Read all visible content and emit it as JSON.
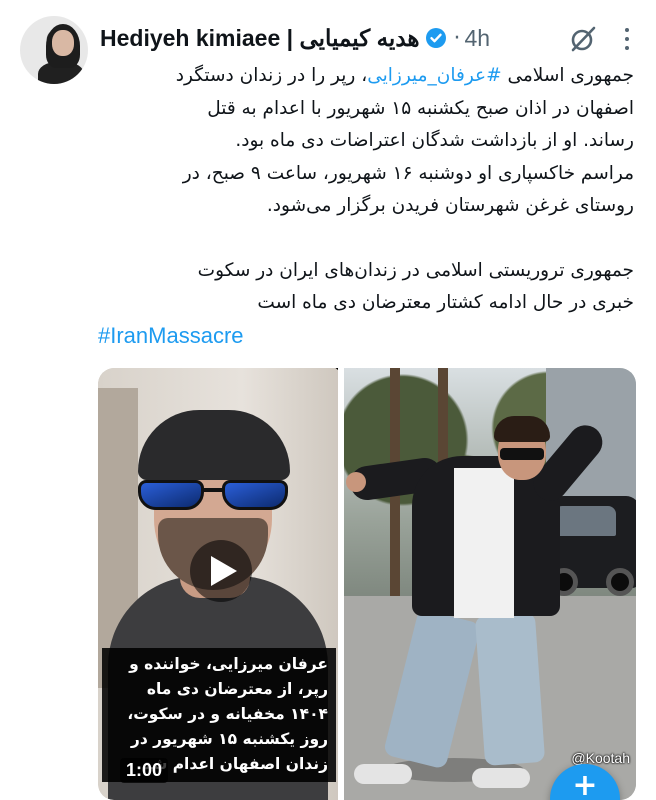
{
  "author": {
    "display_name": "Hediyeh kimiaee | هدیه کیمیایی",
    "separator": "·",
    "time": "4h"
  },
  "post": {
    "lines": [
      {
        "prefix": "جمهوری اسلامی ",
        "hashtag": "#عرفان_میرزایی",
        "suffix": "، رپر را در زندان دستگرد"
      },
      {
        "text": "اصفهان در اذان صبح یکشنبه ۱۵ شهریور با اعدام به قتل"
      },
      {
        "text": "رساند. او از بازداشت شدگان اعتراضات دی ماه بود."
      },
      {
        "text": "مراسم خاکسپاری او دوشنبه ۱۶ شهریور، ساعت ۹ صبح، در"
      },
      {
        "text": "روستای غرغن شهرستان فریدن برگزار می‌شود."
      },
      {
        "text": "جمهوری تروریستی اسلامی در زندان‌های ایران در سکوت"
      },
      {
        "text": "خبری در حال ادامه کشتار معترضان دی ماه است"
      }
    ],
    "hashtag_footer": "#IranMassacre"
  },
  "media": {
    "video_caption_lines": [
      "عرفان میرزایی، خواننده و",
      "رپر، از معترضان دی ماه",
      "۱۴۰۴ مخفیانه و در سکوت،",
      "روز یکشنبه ۱۵ شهریور در",
      "زندان اصفهان اعدام شد"
    ],
    "duration": "1:00",
    "watermark": "@Kootah"
  },
  "icons": {
    "verified": "verified-badge-icon",
    "grok": "grok-icon",
    "more": "more-options-icon",
    "play": "play-icon",
    "compose": "compose-plus-icon"
  },
  "colors": {
    "accent": "#1d9bf0",
    "text": "#0f1419",
    "muted": "#536471"
  }
}
